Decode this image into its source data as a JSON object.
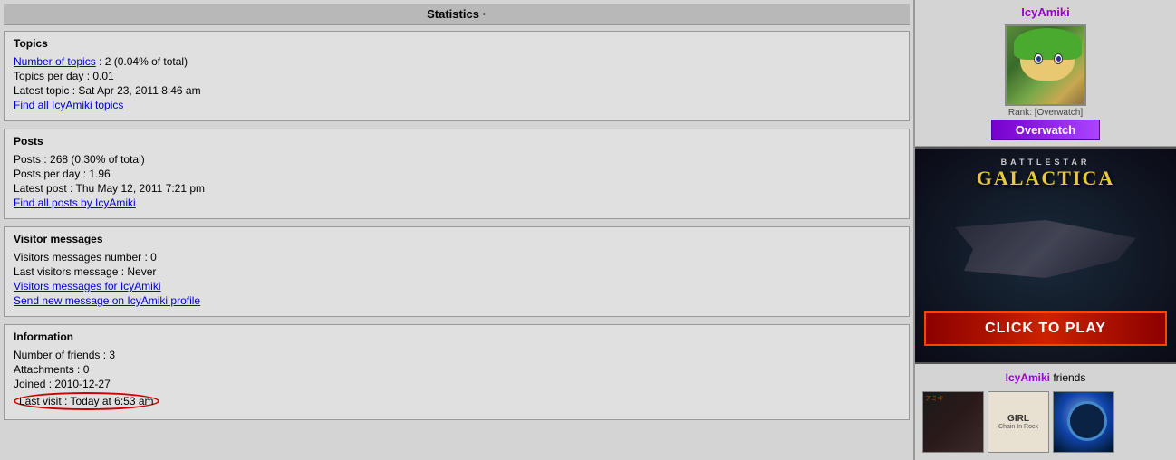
{
  "page": {
    "title": "Statistics ·"
  },
  "header": {
    "label": "Statistics ·"
  },
  "sections": {
    "topics": {
      "title": "Topics",
      "number_of_topics": "Number of topics",
      "number_of_topics_value": " : 2 (0.04% of total)",
      "topics_per_day": "Topics per day : 0.01",
      "latest_topic": "Latest topic : Sat Apr 23, 2011 8:46 am",
      "find_all_link": "Find all IcyAmiki topics"
    },
    "posts": {
      "title": "Posts",
      "posts_count": "Posts : 268 (0.30% of total)",
      "posts_per_day": "Posts per day : 1.96",
      "latest_post": "Latest post : Thu May 12, 2011 7:21 pm",
      "find_all_link": "Find all posts by IcyAmiki"
    },
    "visitor_messages": {
      "title": "Visitor messages",
      "visitors_number": "Visitors messages number : 0",
      "last_message": "Last visitors message : Never",
      "visitor_messages_link": "Visitors messages for IcyAmiki",
      "send_message_link": "Send new message on IcyAmiki profile"
    },
    "information": {
      "title": "Information",
      "friends": "Number of friends : 3",
      "attachments": "Attachments : 0",
      "joined": "Joined : 2010-12-27",
      "last_visit": "Last visit : Today at 6:53 am"
    }
  },
  "sidebar": {
    "username": "IcyAmiki",
    "rank_label": "Rank: [Overwatch]",
    "rank_badge": "Overwatch",
    "ad": {
      "battlestar": "BATTLESTAR",
      "galactica": "GALACTICA",
      "cta": "CLICK TO PLAY"
    },
    "friends_section": {
      "label_prefix": "IcyAmiki",
      "label_suffix": " friends"
    }
  }
}
